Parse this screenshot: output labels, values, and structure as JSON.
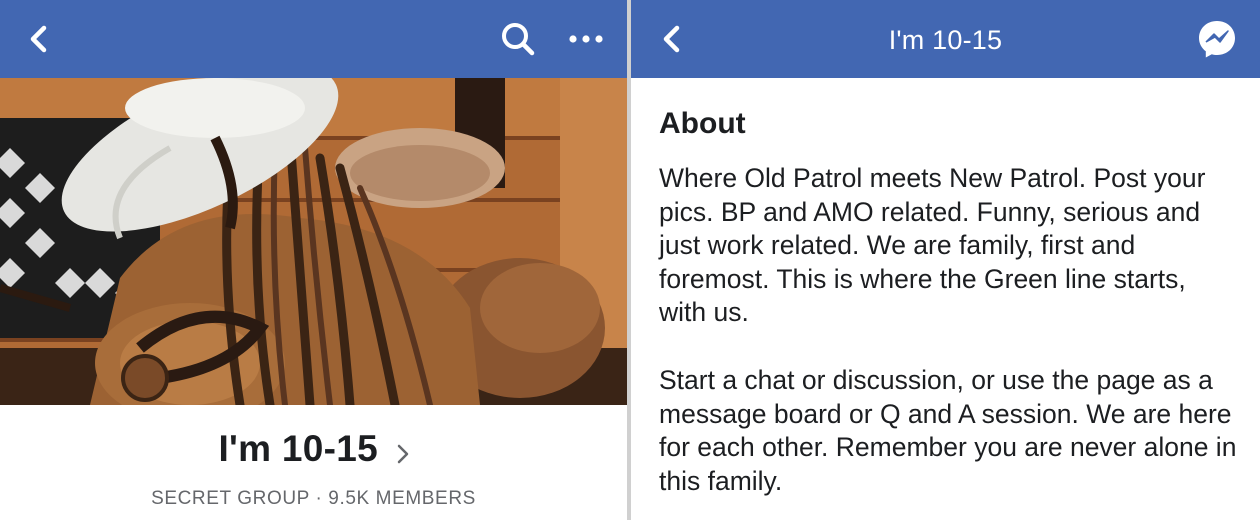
{
  "left_screen": {
    "navbar": {
      "back_icon": "chevron-left-icon",
      "search_icon": "search-icon",
      "more_icon": "ellipsis-icon"
    },
    "cover_photo": {
      "description_icon": "photo"
    },
    "group": {
      "name": "I'm 10-15",
      "meta": "SECRET GROUP · 9.5K MEMBERS"
    }
  },
  "right_screen": {
    "navbar": {
      "title": "I'm 10-15",
      "back_icon": "chevron-left-icon",
      "messenger_icon": "messenger-icon"
    },
    "about": {
      "heading": "About",
      "paragraphs": [
        "Where Old Patrol meets New Patrol. Post your pics. BP and AMO related. Funny, serious and just work related. We are family, first and foremost. This is where the Green line starts, with us.",
        "Start a chat or discussion, or use the page as a message board or Q and A session. We are here for each other. Remember you are never alone in this family."
      ]
    }
  },
  "colors": {
    "navbar": "#4267b2",
    "text": "#1c1e21",
    "meta": "#65676b"
  }
}
